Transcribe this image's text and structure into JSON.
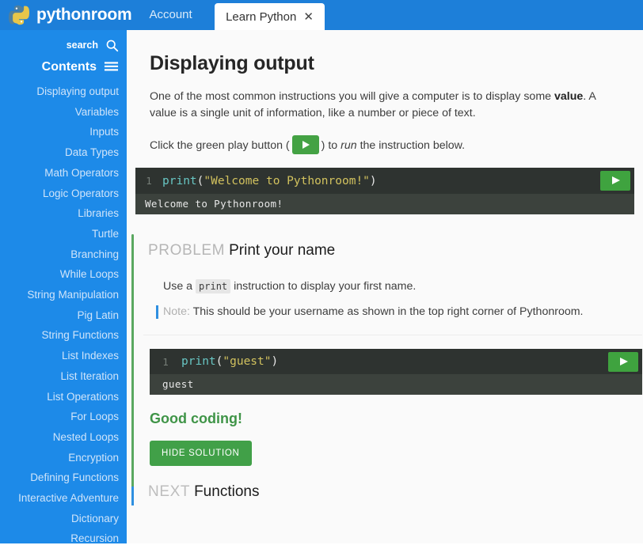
{
  "topbar": {
    "brand": "pythonroom",
    "logo_icon": "python-logo-icon",
    "account_label": "Account",
    "tab": {
      "label": "Learn Python",
      "close_icon": "close-icon",
      "close_glyph": "✕"
    }
  },
  "sidebar": {
    "search_label": "search",
    "search_icon": "search-icon",
    "contents_label": "Contents",
    "menu_icon": "hamburger-menu-icon",
    "items": [
      {
        "label": "Displaying output"
      },
      {
        "label": "Variables"
      },
      {
        "label": "Inputs"
      },
      {
        "label": "Data Types"
      },
      {
        "label": "Math Operators"
      },
      {
        "label": "Logic Operators"
      },
      {
        "label": "Libraries"
      },
      {
        "label": "Turtle"
      },
      {
        "label": "Branching"
      },
      {
        "label": "While Loops"
      },
      {
        "label": "String Manipulation"
      },
      {
        "label": "Pig Latin"
      },
      {
        "label": "String Functions"
      },
      {
        "label": "List Indexes"
      },
      {
        "label": "List Iteration"
      },
      {
        "label": "List Operations"
      },
      {
        "label": "For Loops"
      },
      {
        "label": "Nested Loops"
      },
      {
        "label": "Encryption"
      },
      {
        "label": "Defining Functions"
      },
      {
        "label": "Interactive Adventure"
      },
      {
        "label": "Dictionary"
      },
      {
        "label": "Recursion"
      }
    ]
  },
  "lesson": {
    "title": "Displaying output",
    "intro_part1": "One of the most common instructions you will give a computer is to display some ",
    "intro_bold": "value",
    "intro_part2": ". A value is a single unit of information, like a number or piece of text.",
    "play_part1": "Click the green play button (",
    "play_part2": ") to ",
    "play_italic": "run",
    "play_part3": " the instruction below.",
    "play_icon": "play-icon"
  },
  "demo_editor": {
    "line_number": "1",
    "code": {
      "fn": "print",
      "open_paren": "(",
      "string": "\"Welcome to Pythonroom!\"",
      "close_paren": ")"
    },
    "run_icon": "play-icon",
    "output": "Welcome to Pythonroom!"
  },
  "problem": {
    "kicker": "PROBLEM",
    "title": "Print your name",
    "instruction_part1": "Use a ",
    "instruction_code": "print",
    "instruction_part2": " instruction to display your first name.",
    "note_label": "Note:",
    "note_text": " This should be your username as shown in the top right corner of Pythonroom.",
    "editor": {
      "line_number": "1",
      "code": {
        "fn": "print",
        "open_paren": "(",
        "string": "\"guest\"",
        "close_paren": ")"
      },
      "run_icon": "play-icon",
      "output": "guest"
    },
    "success_message": "Good coding!",
    "hide_solution_label": "HIDE SOLUTION"
  },
  "next": {
    "kicker": "NEXT",
    "title": "Functions"
  },
  "colors": {
    "brand_blue": "#1d7fd9",
    "sidebar_blue": "#1d8ae8",
    "accent_green": "#41a048",
    "editor_bg": "#2e3330",
    "console_bg": "#3c423d",
    "note_blue": "#2f8fe0"
  }
}
